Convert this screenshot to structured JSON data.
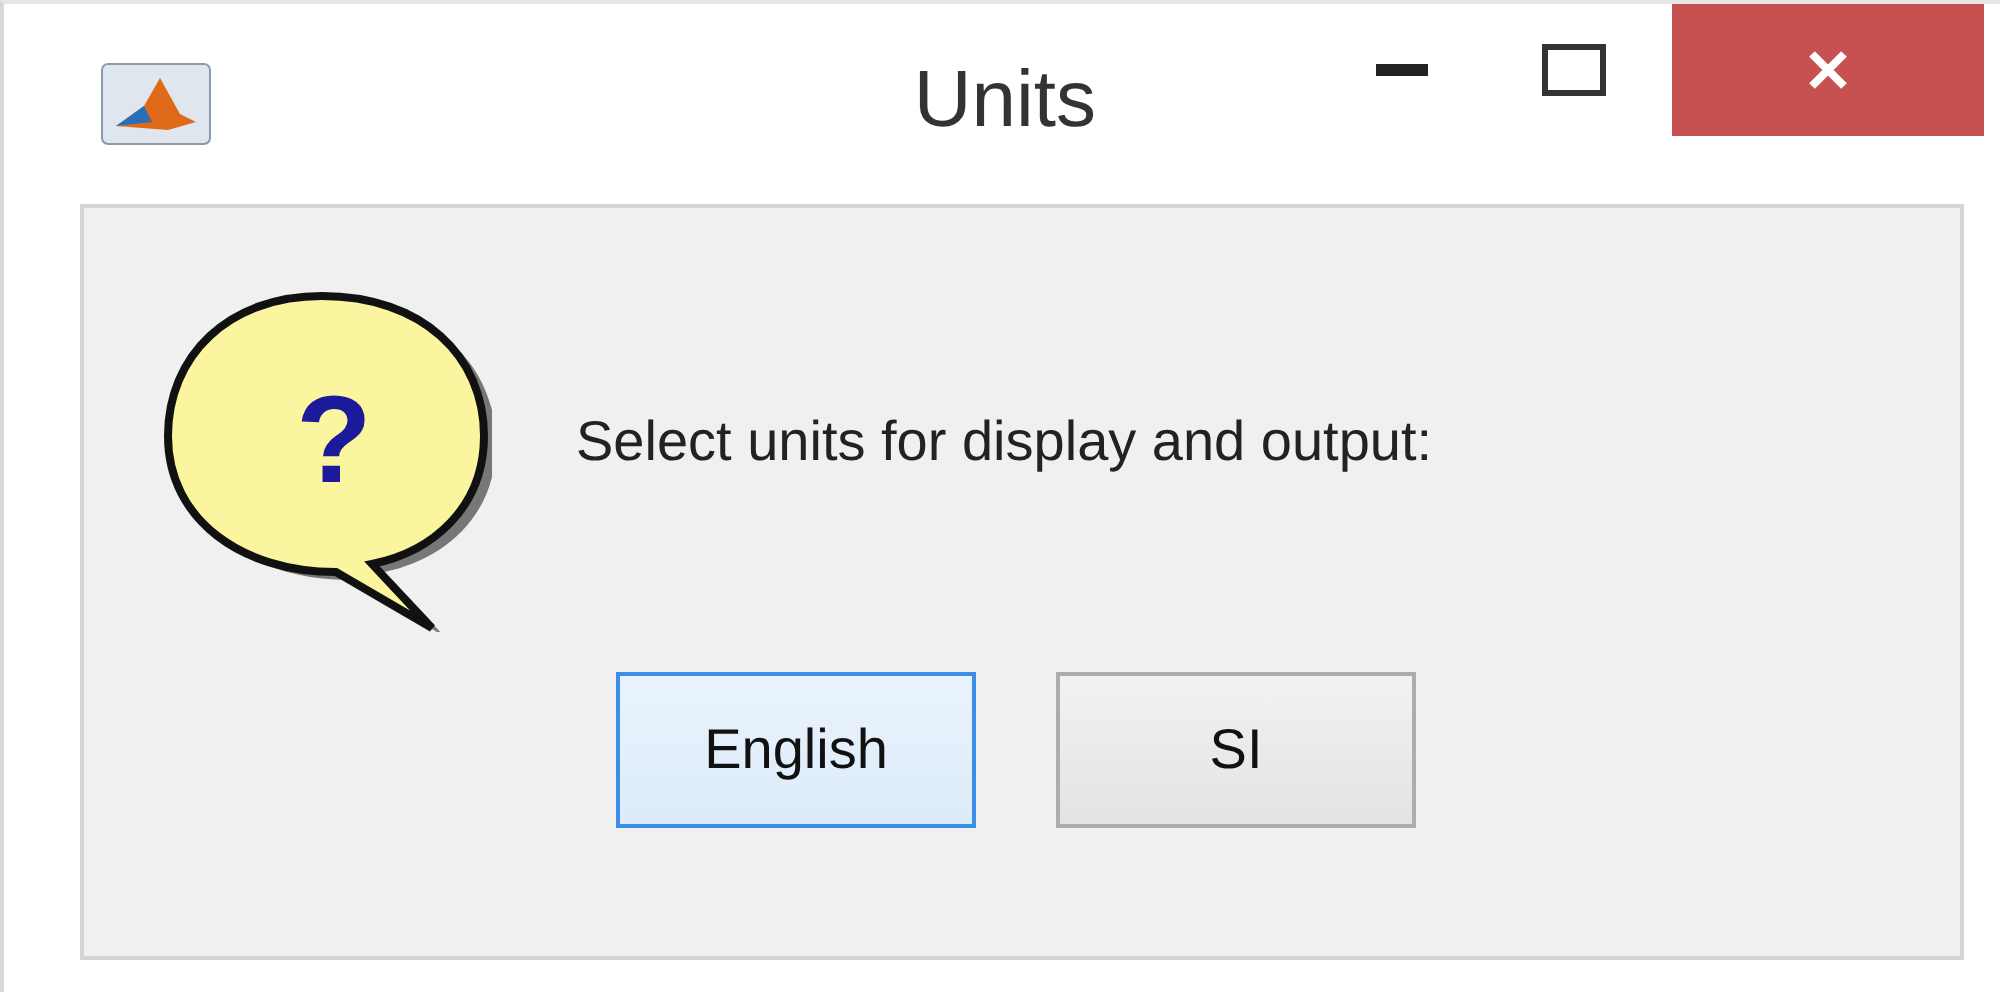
{
  "window": {
    "title": "Units"
  },
  "dialog": {
    "icon_glyph": "?",
    "message": "Select units for display and output:"
  },
  "buttons": [
    {
      "label": "English",
      "focused": true
    },
    {
      "label": "SI",
      "focused": false
    }
  ]
}
